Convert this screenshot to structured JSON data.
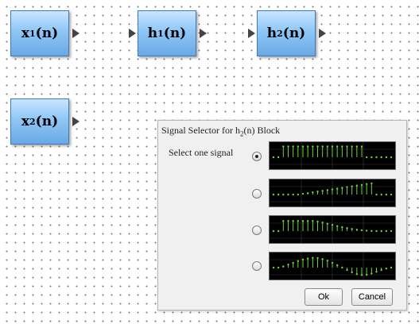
{
  "blocks": [
    {
      "id": "x1",
      "base": "x",
      "sub": "1",
      "arg": "(n)"
    },
    {
      "id": "h1",
      "base": "h",
      "sub": "1",
      "arg": "(n)"
    },
    {
      "id": "h2",
      "base": "h",
      "sub": "2",
      "arg": "(n)"
    },
    {
      "id": "x2",
      "base": "x",
      "sub": "2",
      "arg": "(n)"
    }
  ],
  "dialog": {
    "title_prefix": "Signal Selector for h",
    "title_sub": "2",
    "title_suffix": "(n) Block",
    "prompt": "Select one signal",
    "selected_index": 0,
    "ok_label": "Ok",
    "cancel_label": "Cancel",
    "plot_colors": {
      "background": "#000000",
      "grid": "#3a3a3a",
      "stem": "#6fd13a",
      "axis": "#7fbf7f"
    },
    "signals": [
      {
        "name": "rect",
        "values": [
          0,
          0,
          0.9,
          0.9,
          0.9,
          0.9,
          0.9,
          0.9,
          0.9,
          0.9,
          0.9,
          0.9,
          0.9,
          0.9,
          0.9,
          0.9,
          0.9,
          0.9,
          0.9,
          0,
          0,
          0,
          0,
          0,
          0
        ]
      },
      {
        "name": "ramp",
        "values": [
          0,
          0,
          0,
          0,
          0,
          0,
          0.06,
          0.12,
          0.19,
          0.25,
          0.31,
          0.38,
          0.44,
          0.5,
          0.56,
          0.63,
          0.69,
          0.75,
          0.81,
          0.88,
          0.94,
          0,
          0,
          0,
          0
        ]
      },
      {
        "name": "decay",
        "values": [
          0,
          0,
          0.85,
          0.85,
          0.85,
          0.85,
          0.85,
          0.85,
          0.85,
          0.8,
          0.72,
          0.62,
          0.52,
          0.42,
          0.33,
          0.25,
          0.18,
          0.12,
          0.07,
          0.03,
          0.01,
          0,
          0,
          0,
          0
        ]
      },
      {
        "name": "sine",
        "values": [
          0,
          0,
          0.1,
          0.25,
          0.4,
          0.55,
          0.68,
          0.77,
          0.82,
          0.8,
          0.72,
          0.58,
          0.4,
          0.2,
          0,
          -0.2,
          -0.4,
          -0.55,
          -0.62,
          -0.6,
          -0.5,
          -0.35,
          -0.2,
          -0.08,
          0
        ]
      }
    ]
  }
}
